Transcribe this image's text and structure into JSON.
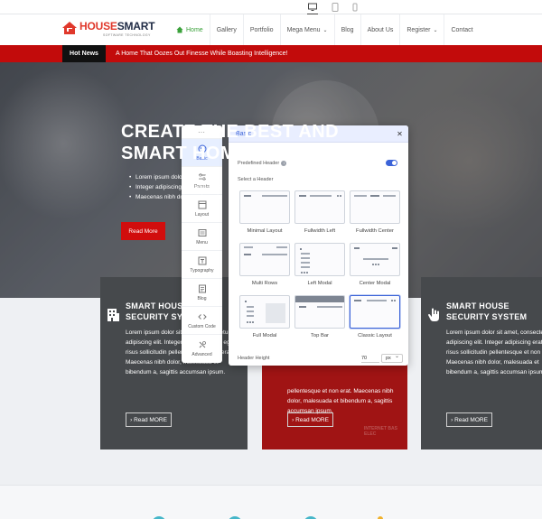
{
  "device_bar": {
    "devices": [
      "desktop",
      "tablet",
      "mobile"
    ],
    "active": "desktop"
  },
  "site": {
    "logo": {
      "brand_a": "HOUSE",
      "brand_b": "SMART",
      "tagline": "SOFTWARE TECHNOLOGY"
    },
    "nav": [
      {
        "label": "Home",
        "active": true
      },
      {
        "label": "Gallery"
      },
      {
        "label": "Portfolio"
      },
      {
        "label": "Mega Menu",
        "dropdown": true
      },
      {
        "label": "Blog"
      },
      {
        "label": "About Us"
      },
      {
        "label": "Register",
        "dropdown": true
      },
      {
        "label": "Contact"
      }
    ],
    "hot_news": {
      "label": "Hot News",
      "text": "A Home That Oozes Out Finesse While Boasting Intelligence!"
    },
    "hero": {
      "title_line1": "CREATE THE BEST AND",
      "title_line2": "SMART HOMES",
      "bullets": [
        "Lorem ipsum dolor sit amet",
        "Integer adipiscing erat eget risus",
        "Maecenas nibh dolor, malesuada"
      ],
      "cta": "Read More"
    },
    "cards": [
      {
        "title_line1": "SMART HOUSE",
        "title_line2": "SECURITY SYSTEM",
        "body": "Lorem ipsum dolor sit amet, consectetur adipiscing elit. Integer adipiscing erat eget risus sollicitudin pellentesque et non erat. Maecenas nibh dolor, malesuada et bibendum a, sagittis accumsan ipsum.",
        "button": "Read MORE"
      },
      {
        "title_line1": "",
        "title_line2": "",
        "body": "pellentesque et non erat. Maecenas nibh dolor, malesuada et bibendum a, sagittis accumsan ipsum.",
        "button": "Read MORE",
        "watermark": "INTERNET BAS ELEC"
      },
      {
        "title_line1": "SMART HOUSE",
        "title_line2": "SECURITY SYSTEM",
        "body": "Lorem ipsum dolor sit amet, consectetur adipiscing elit. Integer adipiscing erat eget risus sollicitudin pellentesque et non erat. Maecenas nibh dolor, malesuada et bibendum a, sagittis accumsan ipsum.",
        "button": "Read MORE"
      }
    ]
  },
  "sidebar": {
    "items": [
      {
        "label": "Basic",
        "icon": "palette-icon",
        "active": true
      },
      {
        "label": "Presets",
        "icon": "sliders-icon"
      },
      {
        "label": "Layout",
        "icon": "layout-icon"
      },
      {
        "label": "Menu",
        "icon": "menu-icon"
      },
      {
        "label": "Typography",
        "icon": "typography-icon"
      },
      {
        "label": "Blog",
        "icon": "blog-icon"
      },
      {
        "label": "Custom Code",
        "icon": "code-icon"
      },
      {
        "label": "Advanced",
        "icon": "advanced-icon"
      }
    ]
  },
  "panel": {
    "title": "Basic",
    "predefined_header_label": "Predefined Header",
    "predefined_header_enabled": true,
    "select_header_label": "Select a Header",
    "layouts": [
      {
        "name": "Minimal Layout"
      },
      {
        "name": "Fullwidth Left"
      },
      {
        "name": "Fullwidth Center"
      },
      {
        "name": "Multi Rows"
      },
      {
        "name": "Left Modal"
      },
      {
        "name": "Center Modal"
      },
      {
        "name": "Full Modal"
      },
      {
        "name": "Top Bar"
      },
      {
        "name": "Classic Layout",
        "selected": true
      }
    ],
    "header_height_label": "Header Height",
    "header_height_value": "70",
    "header_height_unit": "px"
  },
  "colors": {
    "accent": "#3b63d8",
    "hot_news_bg": "#c20b0b",
    "cta_red": "#d10d0d",
    "nav_active": "#3aa13a",
    "card_dark": "#46494c",
    "card_red": "#a01414"
  }
}
